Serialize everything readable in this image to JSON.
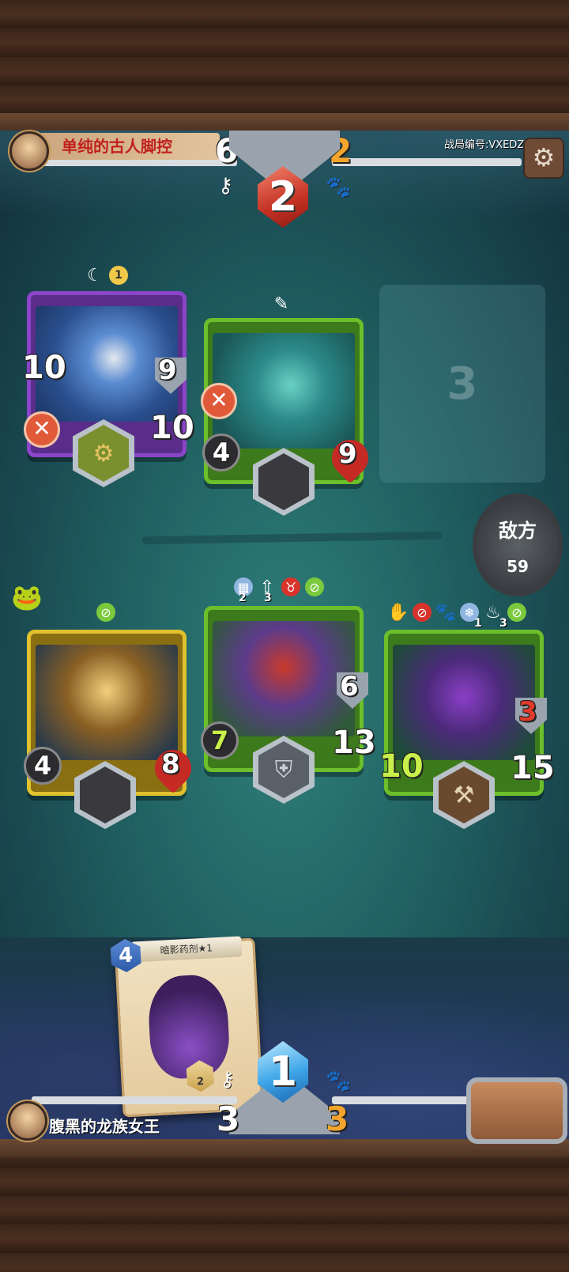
{
  "opponent": {
    "name": "单纯的古人脚控",
    "score_left": "6",
    "score_right": "2",
    "round": "2",
    "match_id": "战局编号:VXEDZ"
  },
  "player": {
    "name": "腹黑的龙族女王",
    "score_left": "3",
    "score_right": "3",
    "round": "1"
  },
  "enemy_button": {
    "label": "敌方",
    "count": "59"
  },
  "empty_slot": {
    "number": "3"
  },
  "enemy_cards": [
    {
      "name": "cannon-tank",
      "color": "purple",
      "top_badge": "1",
      "left_stat": "10",
      "shield": "9",
      "hp": "10"
    },
    {
      "name": "sea-serpent",
      "color": "green",
      "attack": "4",
      "hp": "9"
    }
  ],
  "player_cards": [
    {
      "name": "dwarf-miner",
      "color": "yellow",
      "left_stat": "4",
      "hp": "8"
    },
    {
      "name": "red-maned-ape",
      "color": "green",
      "icons": [
        "2",
        "3"
      ],
      "attack": "7",
      "shield": "6",
      "hp": "13"
    },
    {
      "name": "purple-demon",
      "color": "green",
      "icons": [
        "1",
        "3"
      ],
      "attack": "10",
      "shield": "3",
      "hp": "15"
    }
  ],
  "hand_card": {
    "title": "暗影药剂★1",
    "cost": "4",
    "level": "2"
  },
  "colors": {
    "red_gem": "#c43122",
    "blue_gem": "#3ea6e8",
    "player_name": "#ffffff",
    "opponent_name": "#c0201d"
  }
}
